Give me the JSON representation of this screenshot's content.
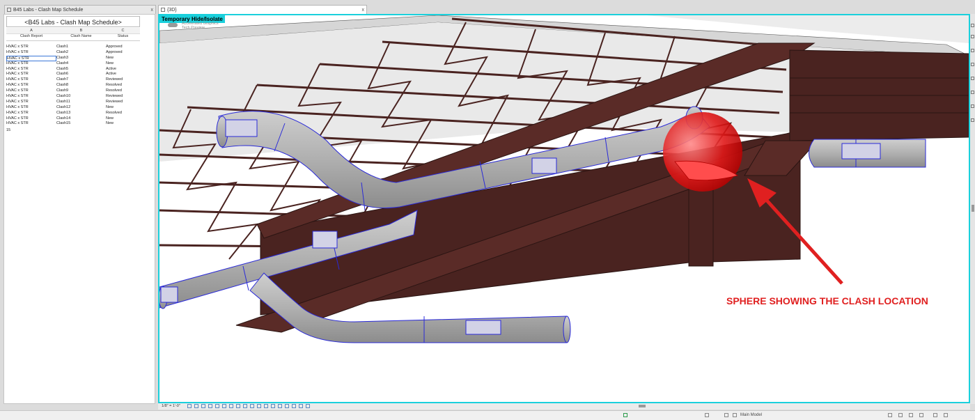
{
  "tabs": {
    "schedule_tab": "B45 Labs - Clash Map Schedule",
    "view_tab": "{3D}",
    "close_glyph": "x"
  },
  "schedule": {
    "title": "<B45 Labs - Clash Map Schedule>",
    "column_letters": [
      "A",
      "B",
      "C"
    ],
    "column_headers": [
      "Clash Report",
      "Clash Name",
      "Status"
    ],
    "rows": [
      {
        "report": "HVAC x STR",
        "name": "Clash1",
        "status": "Approved"
      },
      {
        "report": "HVAC x STR",
        "name": "Clash2",
        "status": "Approved"
      },
      {
        "report": "HVAC x STR",
        "name": "Clash3",
        "status": "New"
      },
      {
        "report": "HVAC x STR",
        "name": "Clash4",
        "status": "New"
      },
      {
        "report": "HVAC x STR",
        "name": "Clash5",
        "status": "Active"
      },
      {
        "report": "HVAC x STR",
        "name": "Clash6",
        "status": "Active"
      },
      {
        "report": "HVAC x STR",
        "name": "Clash7",
        "status": "Reviewed"
      },
      {
        "report": "HVAC x STR",
        "name": "Clash8",
        "status": "Resolved"
      },
      {
        "report": "HVAC x STR",
        "name": "Clash9",
        "status": "Resolved"
      },
      {
        "report": "HVAC x STR",
        "name": "Clash10",
        "status": "Reviewed"
      },
      {
        "report": "HVAC x STR",
        "name": "Clash11",
        "status": "Reviewed"
      },
      {
        "report": "HVAC x STR",
        "name": "Clash12",
        "status": "New"
      },
      {
        "report": "HVAC x STR",
        "name": "Clash13",
        "status": "Resolved"
      },
      {
        "report": "HVAC x STR",
        "name": "Clash14",
        "status": "New"
      },
      {
        "report": "HVAC x STR",
        "name": "Clash15",
        "status": "New"
      }
    ],
    "selected_row": 2,
    "count": "15"
  },
  "viewport": {
    "temp_hide_label": "Temporary Hide/Isolate",
    "graphics_line1": "Accelerated Graphics",
    "graphics_line2": "Tech Preview",
    "annotation": "SPHERE SHOWING THE CLASH LOCATION",
    "colors": {
      "border": "#1ad0dc",
      "steel": "#4a2320",
      "duct": "#b8b8b8",
      "duct_edge": "#2a2ad8",
      "clash_sphere": "#e01010",
      "annotation": "#e02020"
    }
  },
  "view_controls": {
    "scale": "1/8\" = 1'-0\""
  },
  "status_bar": {
    "model": "Main Model"
  }
}
